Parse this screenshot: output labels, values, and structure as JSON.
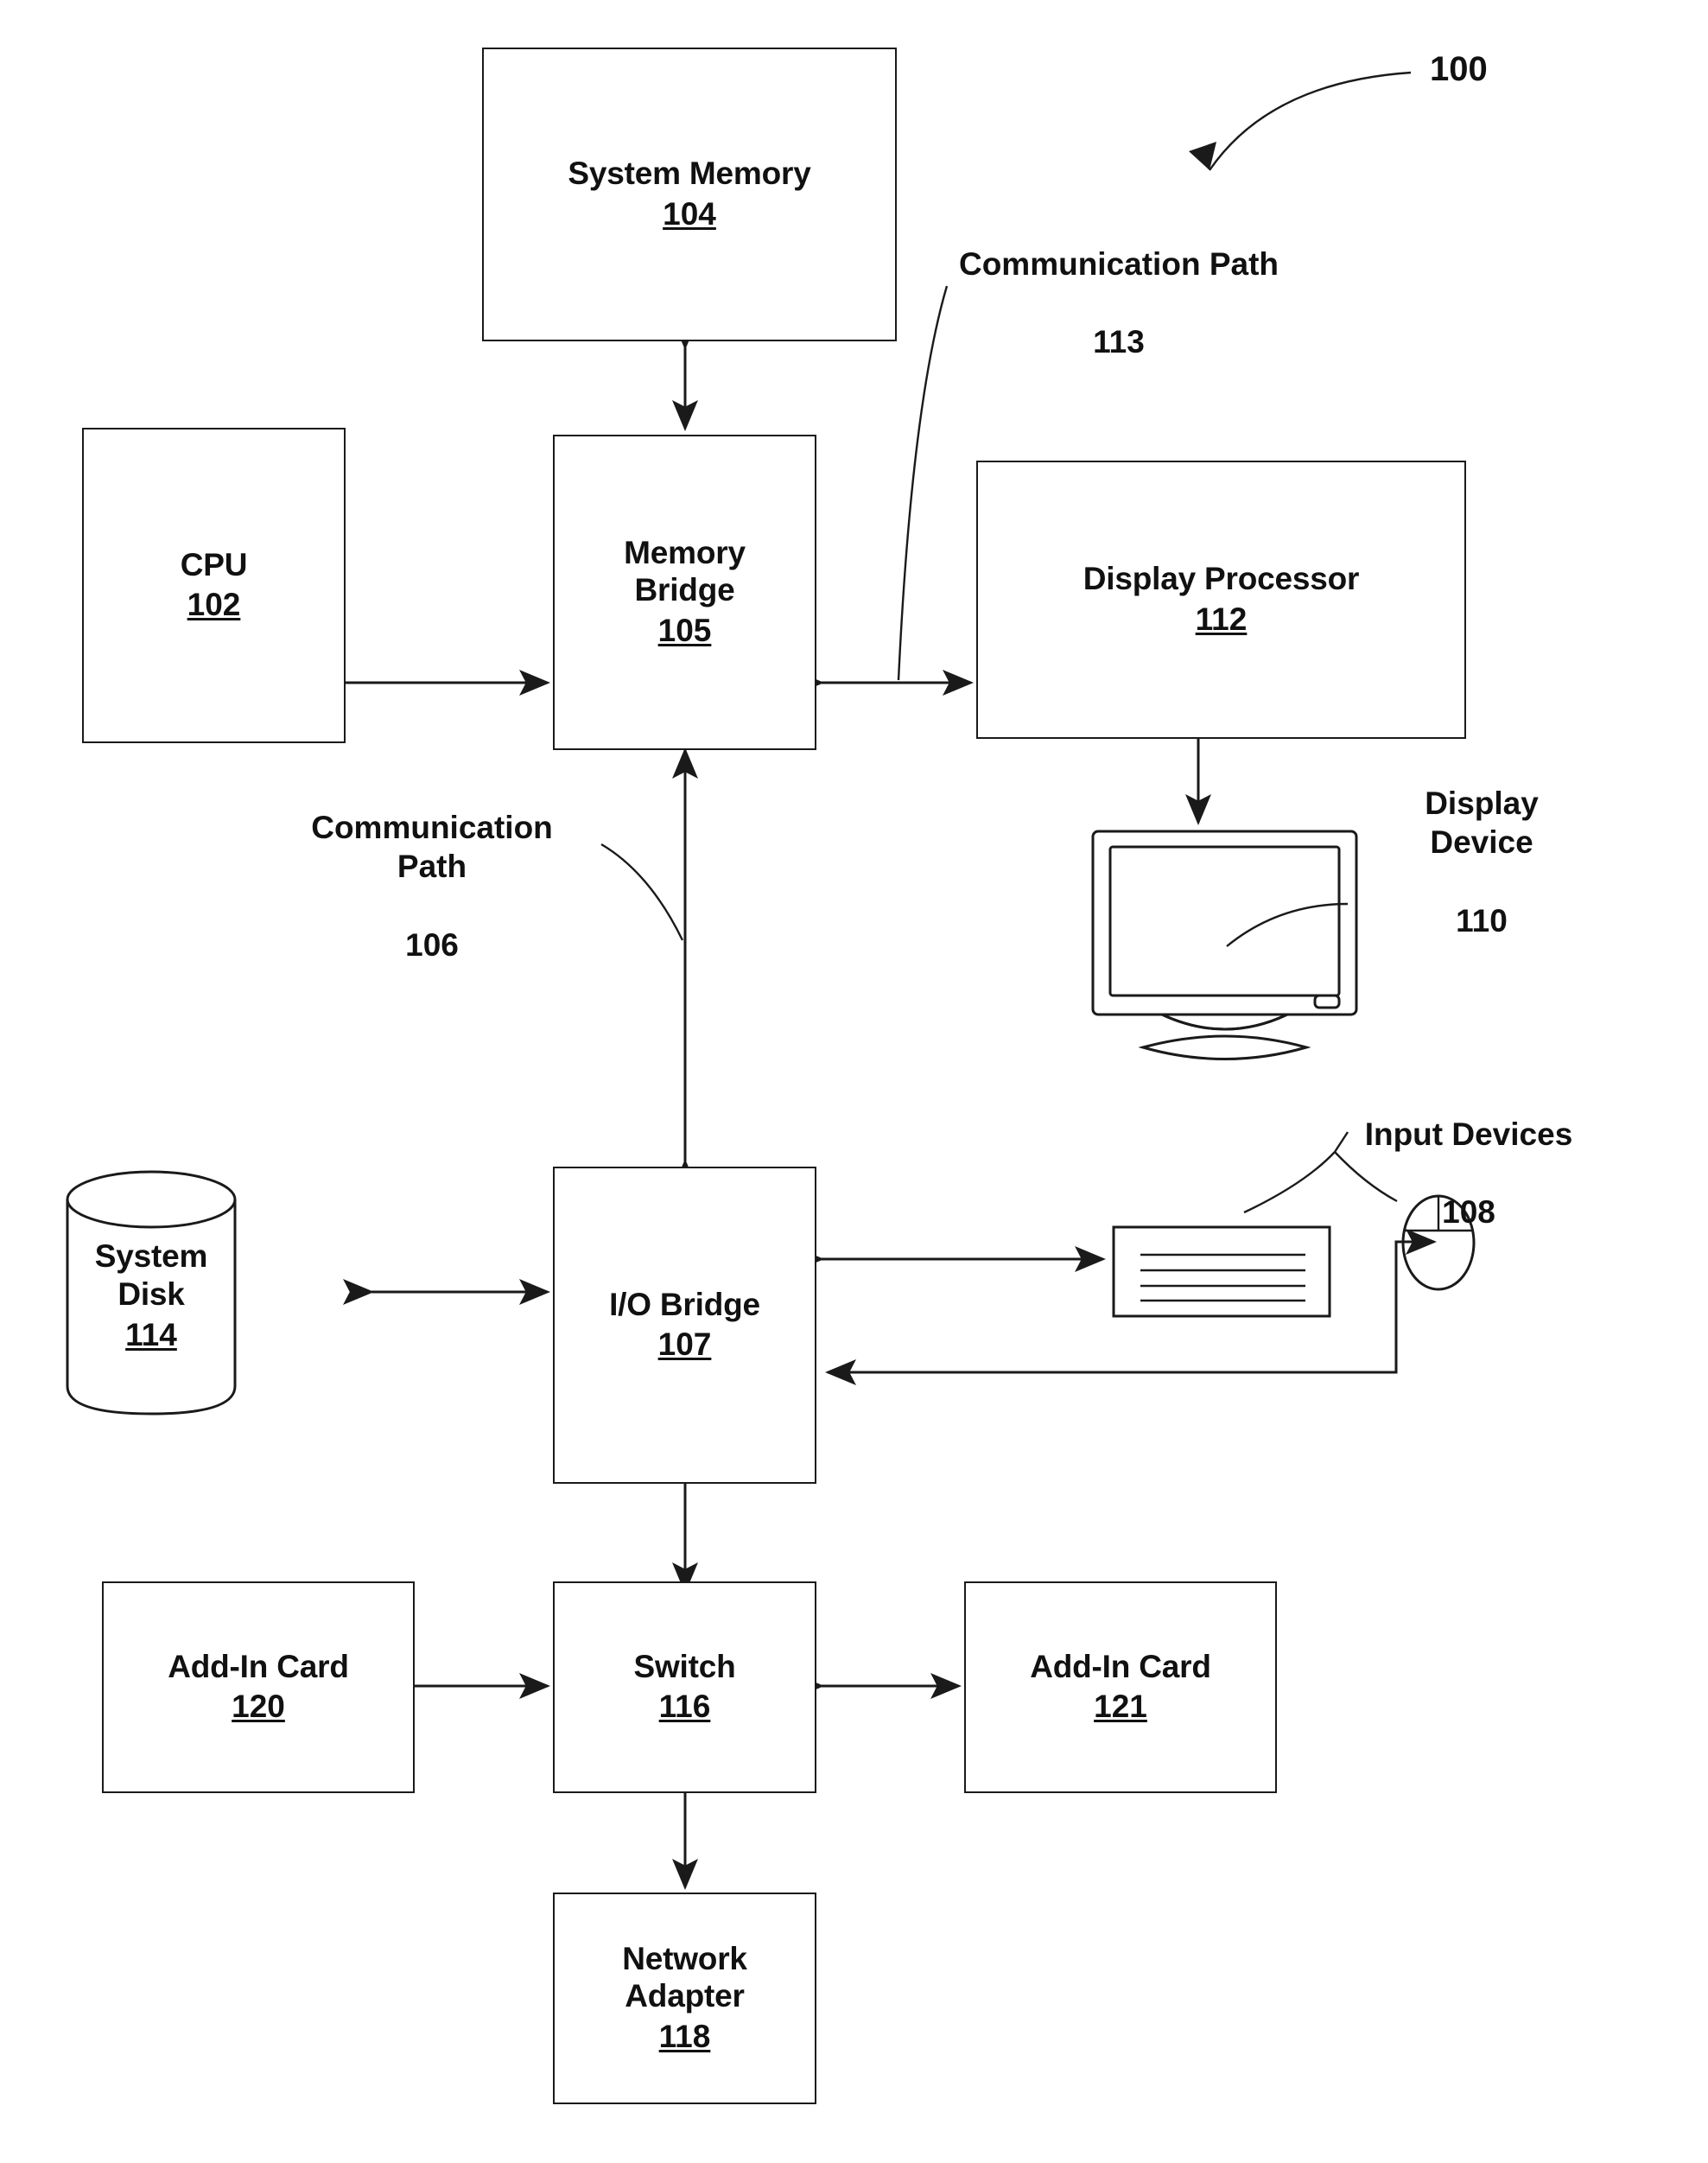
{
  "figure": {
    "reference_number": "100",
    "nodes": [
      {
        "id": "system-memory",
        "title": "System Memory",
        "ref": "104"
      },
      {
        "id": "cpu",
        "title": "CPU",
        "ref": "102"
      },
      {
        "id": "memory-bridge",
        "title": "Memory\nBridge",
        "ref": "105"
      },
      {
        "id": "display-processor",
        "title": "Display Processor",
        "ref": "112"
      },
      {
        "id": "io-bridge",
        "title": "I/O Bridge",
        "ref": "107"
      },
      {
        "id": "system-disk",
        "title": "System\nDisk",
        "ref": "114"
      },
      {
        "id": "add-in-card-120",
        "title": "Add-In Card",
        "ref": "120"
      },
      {
        "id": "switch",
        "title": "Switch",
        "ref": "116"
      },
      {
        "id": "add-in-card-121",
        "title": "Add-In Card",
        "ref": "121"
      },
      {
        "id": "network-adapter",
        "title": "Network\nAdapter",
        "ref": "118"
      }
    ],
    "callouts": [
      {
        "id": "comm-path-113",
        "title": "Communication Path",
        "ref": "113"
      },
      {
        "id": "comm-path-106",
        "title": "Communication\nPath",
        "ref": "106"
      },
      {
        "id": "display-device",
        "title": "Display\nDevice",
        "ref": "110"
      },
      {
        "id": "input-devices",
        "title": "Input Devices",
        "ref": "108"
      }
    ],
    "colors": {
      "line": "#1a1a1a",
      "text": "#111111",
      "background": "#ffffff"
    }
  },
  "nodes": {
    "system_memory": {
      "title": "System Memory",
      "ref": "104"
    },
    "cpu": {
      "title": "CPU",
      "ref": "102"
    },
    "memory_bridge": {
      "title": "Memory\nBridge",
      "ref": "105"
    },
    "display_processor": {
      "title": "Display Processor",
      "ref": "112"
    },
    "io_bridge": {
      "title": "I/O Bridge",
      "ref": "107"
    },
    "system_disk": {
      "title": "System\nDisk",
      "ref": "114"
    },
    "add_in_card_120": {
      "title": "Add-In Card",
      "ref": "120"
    },
    "switch": {
      "title": "Switch",
      "ref": "116"
    },
    "add_in_card_121": {
      "title": "Add-In Card",
      "ref": "121"
    },
    "network_adapter": {
      "title": "Network\nAdapter",
      "ref": "118"
    }
  },
  "callouts": {
    "comm_path_113": {
      "title": "Communication Path",
      "ref": "113"
    },
    "comm_path_106": {
      "title": "Communication\nPath",
      "ref": "106"
    },
    "display_device": {
      "title": "Display\nDevice",
      "ref": "110"
    },
    "input_devices": {
      "title": "Input Devices",
      "ref": "108"
    }
  },
  "figure_ref": "100"
}
